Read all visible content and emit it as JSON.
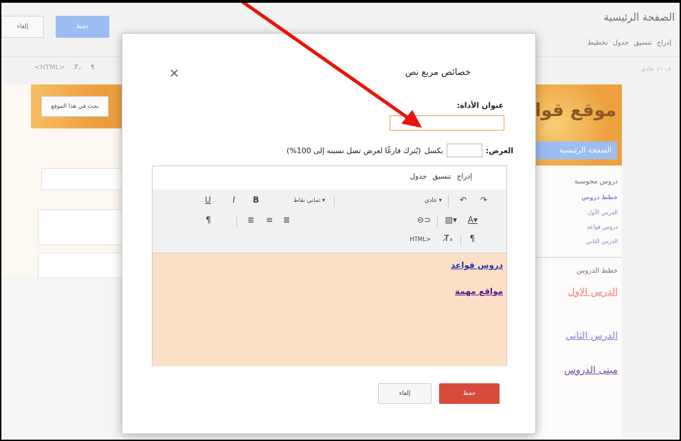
{
  "app": {
    "page_title": "الصفحة الرئيسية",
    "menu": [
      "إدراج",
      "تنسيق",
      "جدول",
      "تخطيط"
    ],
    "save_label": "حفظ",
    "cancel_label": "إلغاء",
    "toolbar_html": "<HTML>",
    "toolbar_style": "عادي"
  },
  "site": {
    "title": "موقع قواعد",
    "search_button": "بحث في هذا الموقع",
    "home_button": "الصفحة الرئيسية",
    "sidebar": {
      "heading1": "دروس محوسبة",
      "items1": [
        "خطط دروس",
        "الدرس الأول",
        "دروس قواعد",
        "الدرس الثاني"
      ],
      "heading2": "خطط الدروس",
      "items2": [
        "الدرس الاول",
        "الدرس الثاني",
        "مبنى الدروس"
      ]
    }
  },
  "dialog": {
    "title": "خصائص مربع نص",
    "tool_title_label": "عنوان الأداة:",
    "tool_title_value": "",
    "width_label": "العرض:",
    "width_value": "",
    "width_unit": "بكسل",
    "width_hint": "(يُترك فارغًا لعرض تصل نسبته إلى 100%)",
    "editor_menu": [
      "إدراج",
      "تنسيق",
      "جدول"
    ],
    "editor_toolbar": {
      "style_select": "عادي",
      "font_select": "ثماني نقاط",
      "html": "HTML>"
    },
    "content_links": [
      "دروس قواعد",
      "مواقع مهمة"
    ],
    "save_label": "حفظ",
    "cancel_label": "إلغاء"
  },
  "colors": {
    "accent_blue": "#8ab2ef",
    "save_red": "#d84b3a",
    "editor_bg": "#fde0c8",
    "annotation_arrow": "#e8140c"
  }
}
